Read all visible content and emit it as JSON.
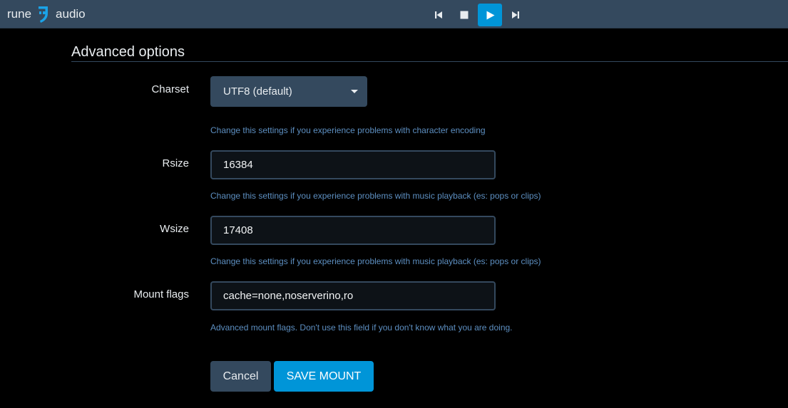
{
  "app": {
    "brand_left": "rune",
    "brand_right": "audio"
  },
  "player": {
    "controls": [
      {
        "name": "previous",
        "icon": "skip-previous-icon"
      },
      {
        "name": "stop",
        "icon": "stop-icon"
      },
      {
        "name": "play",
        "icon": "play-icon",
        "active": true
      },
      {
        "name": "next",
        "icon": "skip-next-icon"
      }
    ]
  },
  "section": {
    "title": "Advanced options"
  },
  "form": {
    "charset": {
      "label": "Charset",
      "value": "UTF8 (default)",
      "help": "Change this settings if you experience problems with character encoding"
    },
    "rsize": {
      "label": "Rsize",
      "value": "16384",
      "help": "Change this settings if you experience problems with music playback (es: pops or clips)"
    },
    "wsize": {
      "label": "Wsize",
      "value": "17408",
      "help": "Change this settings if you experience problems with music playback (es: pops or clips)"
    },
    "mount_flags": {
      "label": "Mount flags",
      "value": "cache=none,noserverino,ro",
      "help": "Advanced mount flags. Don't use this field if you don't know what you are doing."
    }
  },
  "actions": {
    "cancel_label": "Cancel",
    "save_label": "SAVE MOUNT"
  },
  "colors": {
    "topbar": "#34495e",
    "accent": "#0095d8",
    "help_text": "#5d8fc1",
    "background": "#000000"
  }
}
